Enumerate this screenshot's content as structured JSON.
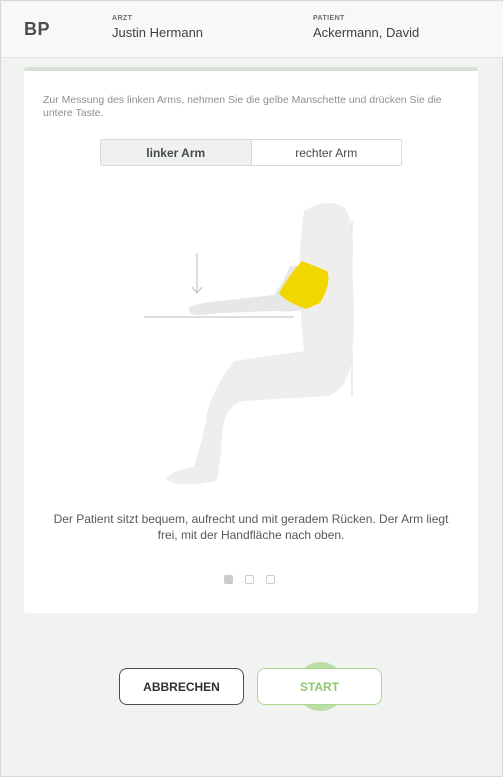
{
  "header": {
    "app_title": "BP",
    "doctor_label": "ARZT",
    "doctor_name": "Justin Hermann",
    "patient_label": "PATIENT",
    "patient_name": "Ackermann, David"
  },
  "card": {
    "instruction": "Zur Messung des linken Arms, nehmen Sie die gelbe Manschette und drücken Sie die untere Taste.",
    "toggle": {
      "left_label": "linker Arm",
      "right_label": "rechter Arm",
      "selected": "linker Arm"
    },
    "description": "Der Patient sitzt bequem, aufrecht und mit geradem Rücken. Der Arm liegt frei, mit der Handfläche nach oben.",
    "pagination": {
      "current": 1,
      "total": 3
    }
  },
  "actions": {
    "cancel_label": "ABBRECHEN",
    "start_label": "START"
  },
  "colors": {
    "accent_green": "#8dc86d",
    "cuff_yellow": "#f2d600",
    "silhouette": "#eeefed"
  },
  "icons": {
    "arrow": "arrow-down-icon",
    "cuff": "cuff-icon"
  }
}
